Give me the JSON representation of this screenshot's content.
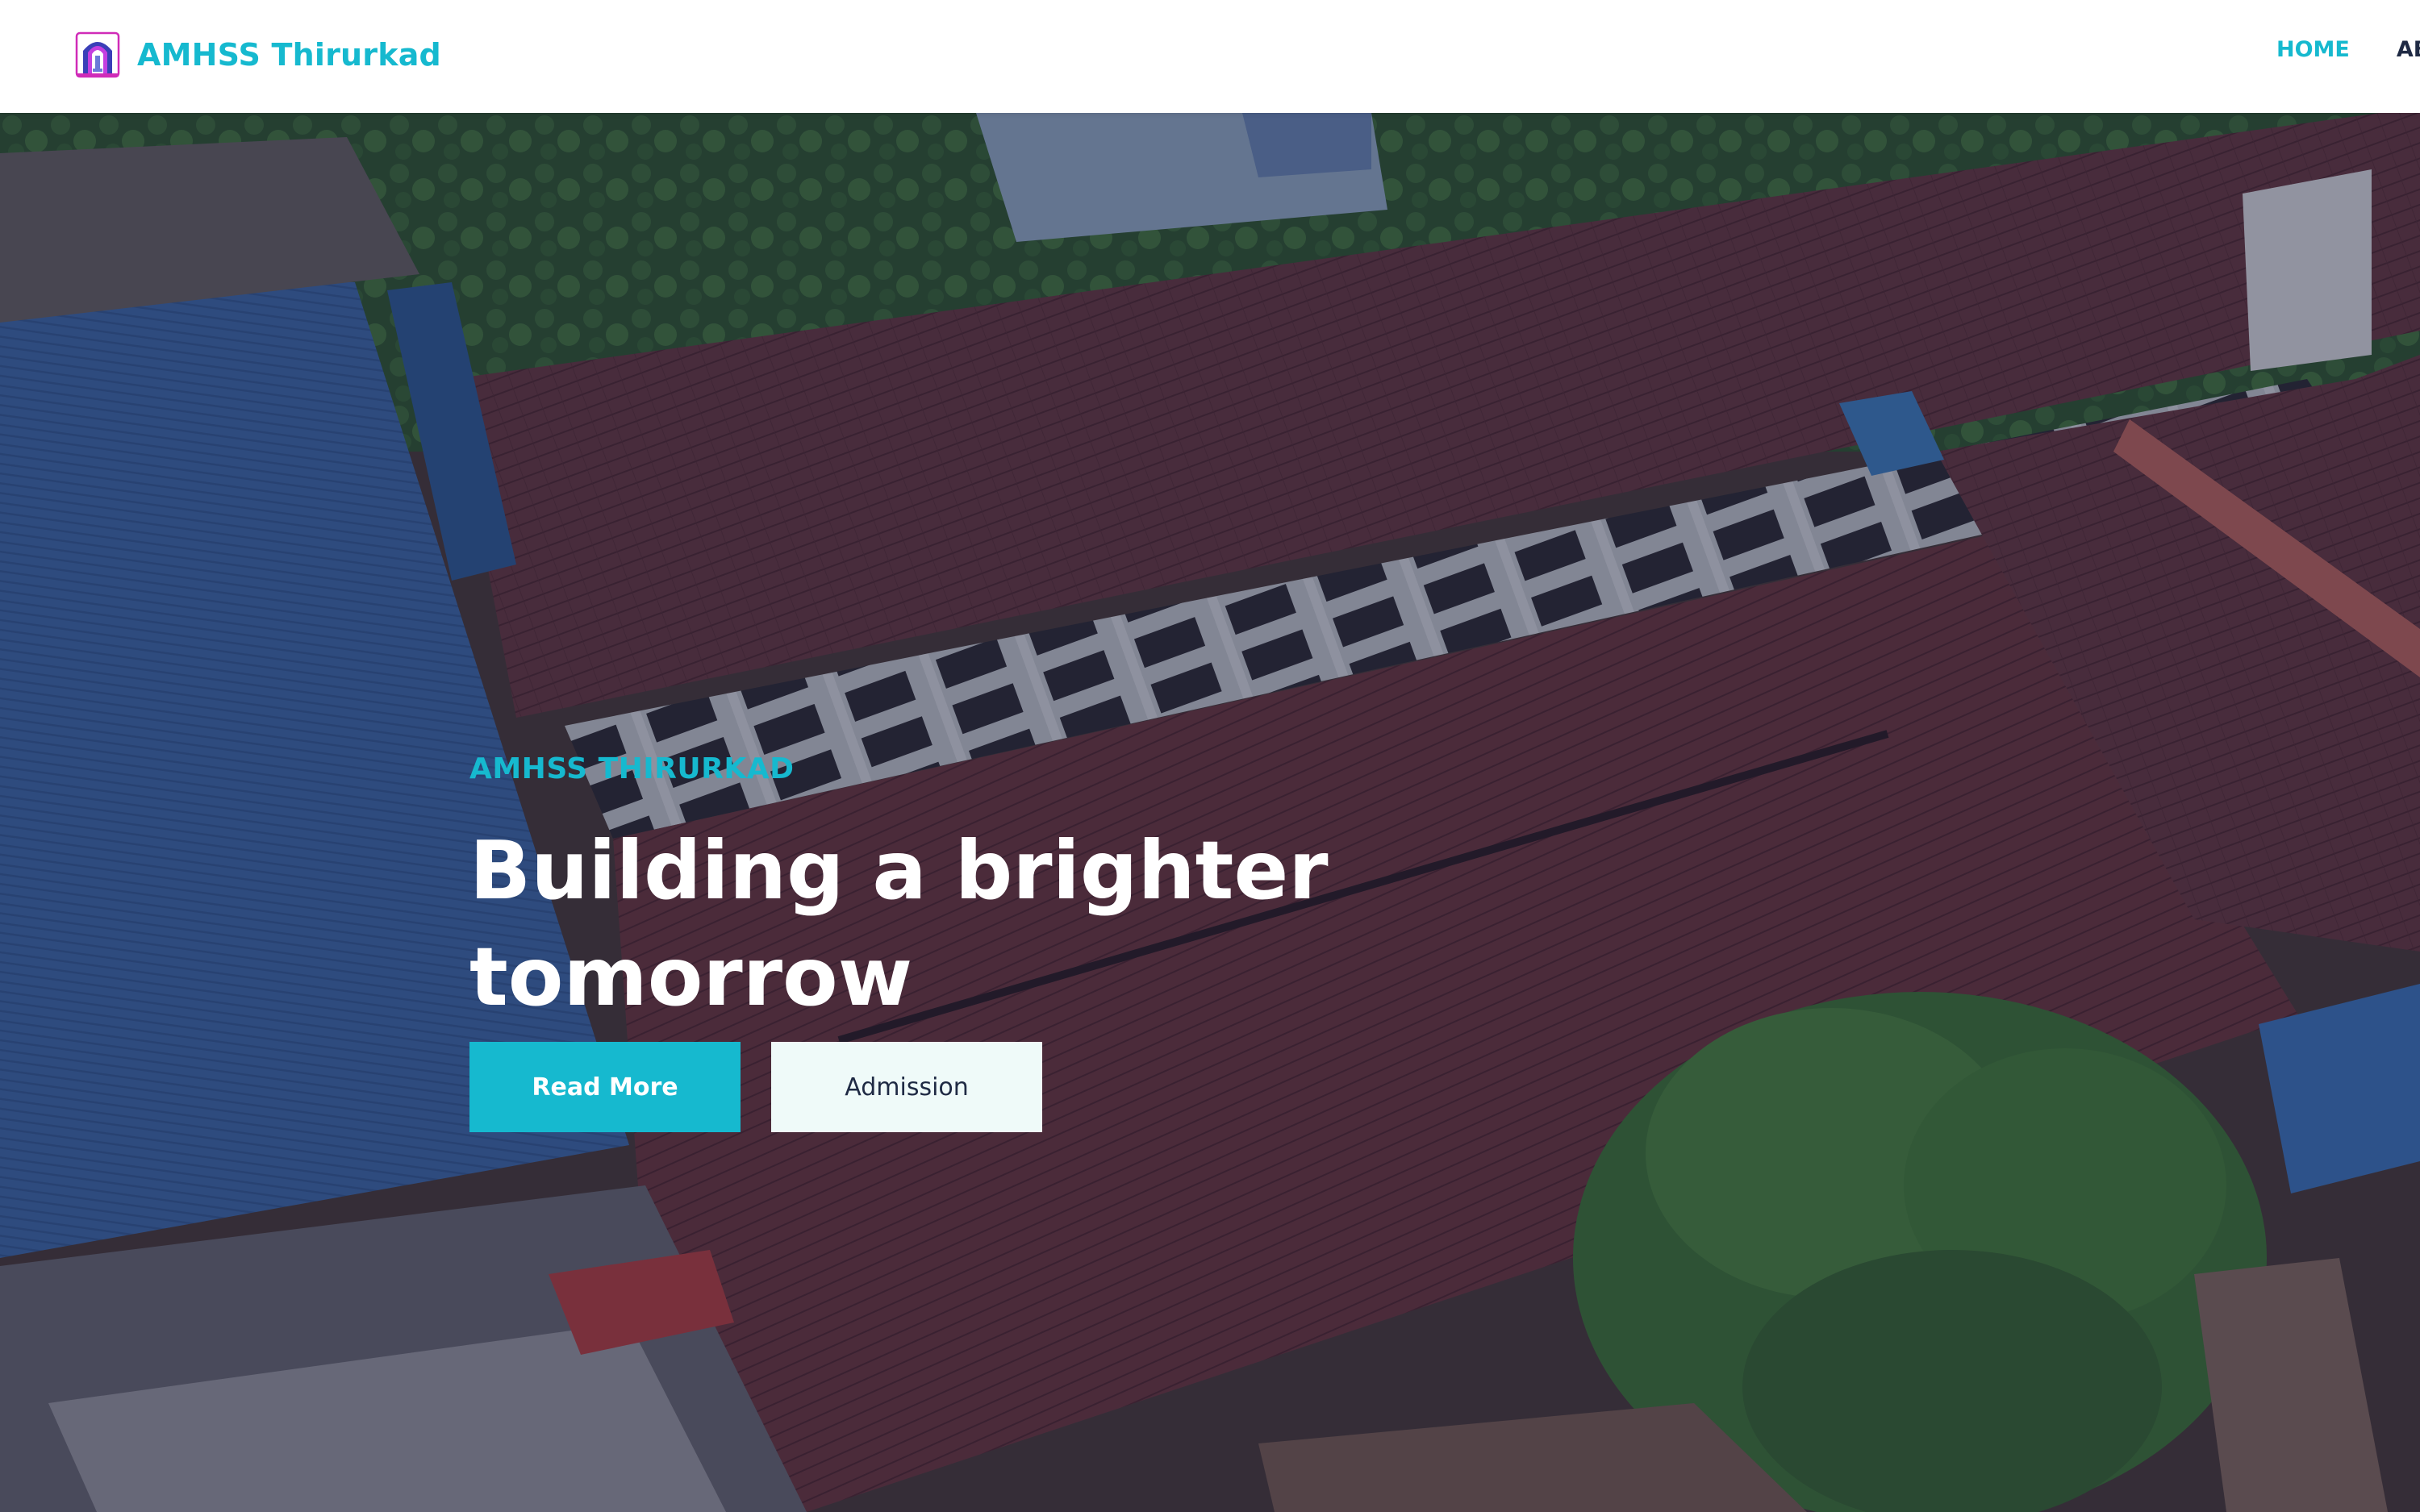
{
  "header": {
    "brand_name": "AMHSS Thirurkad",
    "nav": [
      {
        "label": "Home",
        "active": true
      },
      {
        "label": "About",
        "active": false
      }
    ]
  },
  "hero": {
    "eyebrow": "AMHSS THIRURKAD",
    "title": "Building a brighter tomorrow",
    "buttons": {
      "read_more": "Read More",
      "admission": "Admission"
    },
    "background_description_icon": "school-aerial-photo"
  },
  "colors": {
    "accent": "#16b9cf",
    "nav_text": "#1f2a44",
    "button_secondary_bg": "#effaf9",
    "overlay": "#181a3a"
  }
}
